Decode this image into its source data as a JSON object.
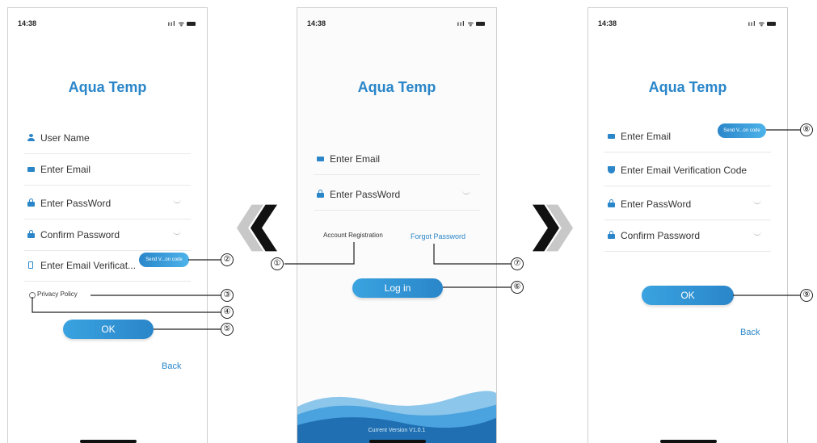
{
  "status_time": "14:38",
  "status_icons": "ııl ᯤ",
  "app_title": "Aqua Temp",
  "left": {
    "fields": [
      "User Name",
      "Enter Email",
      "Enter PassWord",
      "Confirm Password",
      "Enter Email Verificat..."
    ],
    "send_button": "Send V...on code",
    "privacy": "Privacy Policy",
    "ok": "OK",
    "back": "Back"
  },
  "middle": {
    "fields": [
      "Enter Email",
      "Enter PassWord"
    ],
    "account_registration": "Account Registration",
    "forgot_password": "Forgot Password",
    "login": "Log in",
    "version": "Current Version V1.0.1"
  },
  "right": {
    "fields": [
      "Enter Email",
      "Enter Email Verification Code",
      "Enter PassWord",
      "Confirm Password"
    ],
    "send_button": "Send V...on code",
    "ok": "OK",
    "back": "Back"
  },
  "chevrons": {
    "left": "❮",
    "right": "❯"
  },
  "callouts": [
    "①",
    "②",
    "③",
    "④",
    "⑤",
    "⑥",
    "⑦",
    "⑧",
    "⑨"
  ],
  "colors": {
    "accent": "#2a86c9",
    "wave_dark": "#1f6fb2",
    "wave_light": "#4aa3df"
  }
}
